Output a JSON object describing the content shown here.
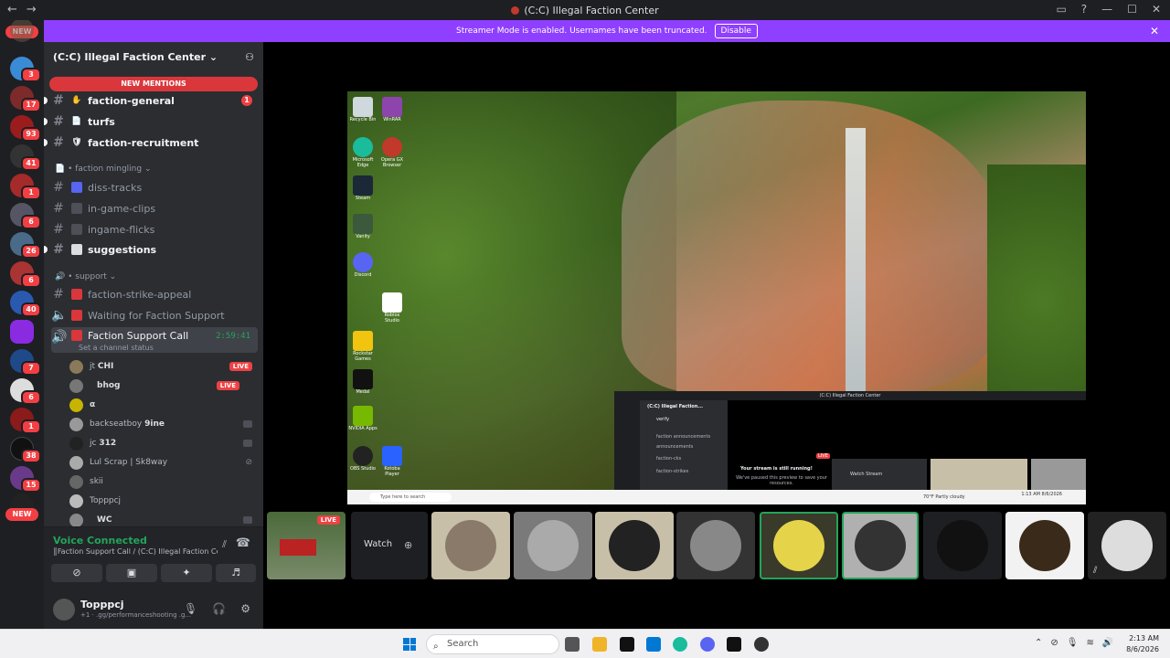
{
  "window": {
    "title": "(C:C) Illegal Faction Center",
    "nav_back": "←",
    "nav_forward": "→",
    "inbox_icon": "inbox-icon",
    "help_icon": "help-icon",
    "min": "—",
    "max": "☐",
    "close": "✕"
  },
  "banner": {
    "text": "Streamer Mode is enabled. Usernames have been truncated.",
    "disable": "Disable",
    "close": "✕"
  },
  "guild_rail": {
    "top_pill": "NEW",
    "bottom_pill": "NEW",
    "badges": [
      "3",
      "17",
      "93",
      "41",
      "1",
      "6",
      "26",
      "6",
      "40",
      "7",
      "6",
      "1",
      "38",
      "15"
    ]
  },
  "server": {
    "name": "(C:C) Illegal Faction Center",
    "chevron": "⌄",
    "new_mentions": "NEW MENTIONS",
    "channels_top": [
      {
        "label": "faction-general",
        "mentions": "1",
        "emoji": "✋"
      },
      {
        "label": "turfs",
        "emoji": "📄"
      },
      {
        "label": "faction-recruitment",
        "emoji": "🛡"
      }
    ],
    "category_mingling": "faction mingling",
    "channels_mingling": [
      {
        "label": "diss-tracks"
      },
      {
        "label": "in-game-clips"
      },
      {
        "label": "ingame-flicks"
      },
      {
        "label": "suggestions"
      }
    ],
    "category_support": "support",
    "channels_support": [
      {
        "label": "faction-strike-appeal"
      },
      {
        "label": "Waiting for Faction Support"
      },
      {
        "label": "Faction Support Call"
      }
    ],
    "call_timer": "2:59:41",
    "channel_status": "Set a channel status",
    "voice_users": [
      {
        "name": "jt",
        "tag": "CHI",
        "live": "LIVE"
      },
      {
        "name": "",
        "tag": "bhog",
        "live": "LIVE"
      },
      {
        "name": "",
        "tag": "α"
      },
      {
        "name": "backseatboy",
        "tag": "9ine"
      },
      {
        "name": "jc",
        "tag": "312"
      },
      {
        "name": "Lul Scrap | Sk8way",
        "tag": ""
      },
      {
        "name": "skii",
        "tag": ""
      },
      {
        "name": "Topppcj",
        "tag": ""
      },
      {
        "name": "",
        "tag": "WC"
      }
    ]
  },
  "voice_panel": {
    "status": "Voice Connected",
    "channel": "║Faction Support Call / (C:C) Illegal Faction Ce...",
    "user": "Topppcj",
    "user_status": "+1 · .gg/performanceshooting .g..."
  },
  "stream": {
    "inner_title": "(C:C) Illegal Faction Center",
    "inner_server": "(C:C) Illegal Faction...",
    "inner_channels": [
      "verify",
      "faction announcements",
      "announcements",
      "faction-cks",
      "faction-strikes"
    ],
    "inner_running": "Your stream is still running!",
    "inner_paused": "We've paused this preview to save your resources.",
    "inner_watch": "Watch Stream",
    "inner_live": "LIVE",
    "desktop_search": "Type here to search",
    "desktop_weather": "70°F  Partly cloudy",
    "desktop_time": "1:13 AM",
    "desktop_date": "8/6/2026",
    "desktop_icons": [
      "Recycle Bin",
      "WinRAR",
      "Microsoft Edge",
      "Opera GX Browser",
      "Steam",
      "Vanity",
      "Discord",
      "Roblox Studio",
      "Rockstar Games",
      "Medal",
      "NVIDIA Apps",
      "OBS Studio",
      "Kotoba Player"
    ]
  },
  "tiles": {
    "live": "LIVE",
    "watch": "Watch"
  },
  "taskbar": {
    "search": "Search",
    "time": "2:13 AM",
    "date": "8/6/2026"
  }
}
